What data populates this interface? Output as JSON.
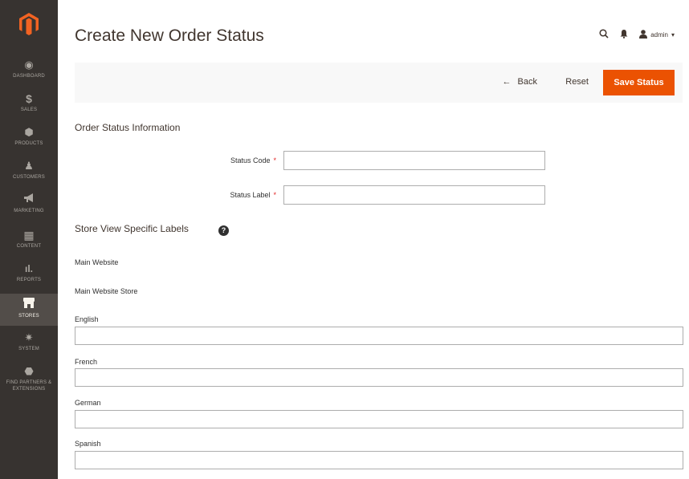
{
  "sidebar": {
    "logo": "magento-logo-icon",
    "items": [
      {
        "label": "DASHBOARD",
        "icon": "dashboard-icon",
        "glyph": "◉",
        "active": false
      },
      {
        "label": "SALES",
        "icon": "dollar-icon",
        "glyph": "$",
        "active": false
      },
      {
        "label": "PRODUCTS",
        "icon": "cube-icon",
        "glyph": "⬢",
        "active": false
      },
      {
        "label": "CUSTOMERS",
        "icon": "person-icon",
        "glyph": "♟",
        "active": false
      },
      {
        "label": "MARKETING",
        "icon": "megaphone-icon",
        "glyph": "📢",
        "active": false
      },
      {
        "label": "CONTENT",
        "icon": "layout-icon",
        "glyph": "▦",
        "active": false
      },
      {
        "label": "REPORTS",
        "icon": "bar-chart-icon",
        "glyph": "ıl.",
        "active": false
      },
      {
        "label": "STORES",
        "icon": "storefront-icon",
        "glyph": "⌂",
        "active": true
      },
      {
        "label": "SYSTEM",
        "icon": "gear-icon",
        "glyph": "✷",
        "active": false
      },
      {
        "label": "FIND PARTNERS & EXTENSIONS",
        "icon": "cube-stack-icon",
        "glyph": "⬣",
        "active": false
      }
    ]
  },
  "header": {
    "title": "Create New Order Status",
    "user": "admin",
    "user_caret": "▾"
  },
  "actions": {
    "back_arrow": "←",
    "back": "Back",
    "reset": "Reset",
    "save": "Save Status"
  },
  "order_status_info": {
    "title": "Order Status Information",
    "status_code_label": "Status Code",
    "status_code_value": "",
    "status_label_label": "Status Label",
    "status_label_value": "",
    "required_mark": "*"
  },
  "store_view_labels": {
    "title": "Store View Specific Labels",
    "help": "?",
    "website": "Main Website",
    "store": "Main Website Store",
    "languages": [
      {
        "label": "English",
        "value": ""
      },
      {
        "label": "French",
        "value": ""
      },
      {
        "label": "German",
        "value": ""
      },
      {
        "label": "Spanish",
        "value": ""
      }
    ]
  },
  "colors": {
    "sidebar_bg": "#373330",
    "sidebar_active": "#524d49",
    "accent": "#eb5202",
    "logo": "#f26322",
    "title": "#41362f"
  }
}
